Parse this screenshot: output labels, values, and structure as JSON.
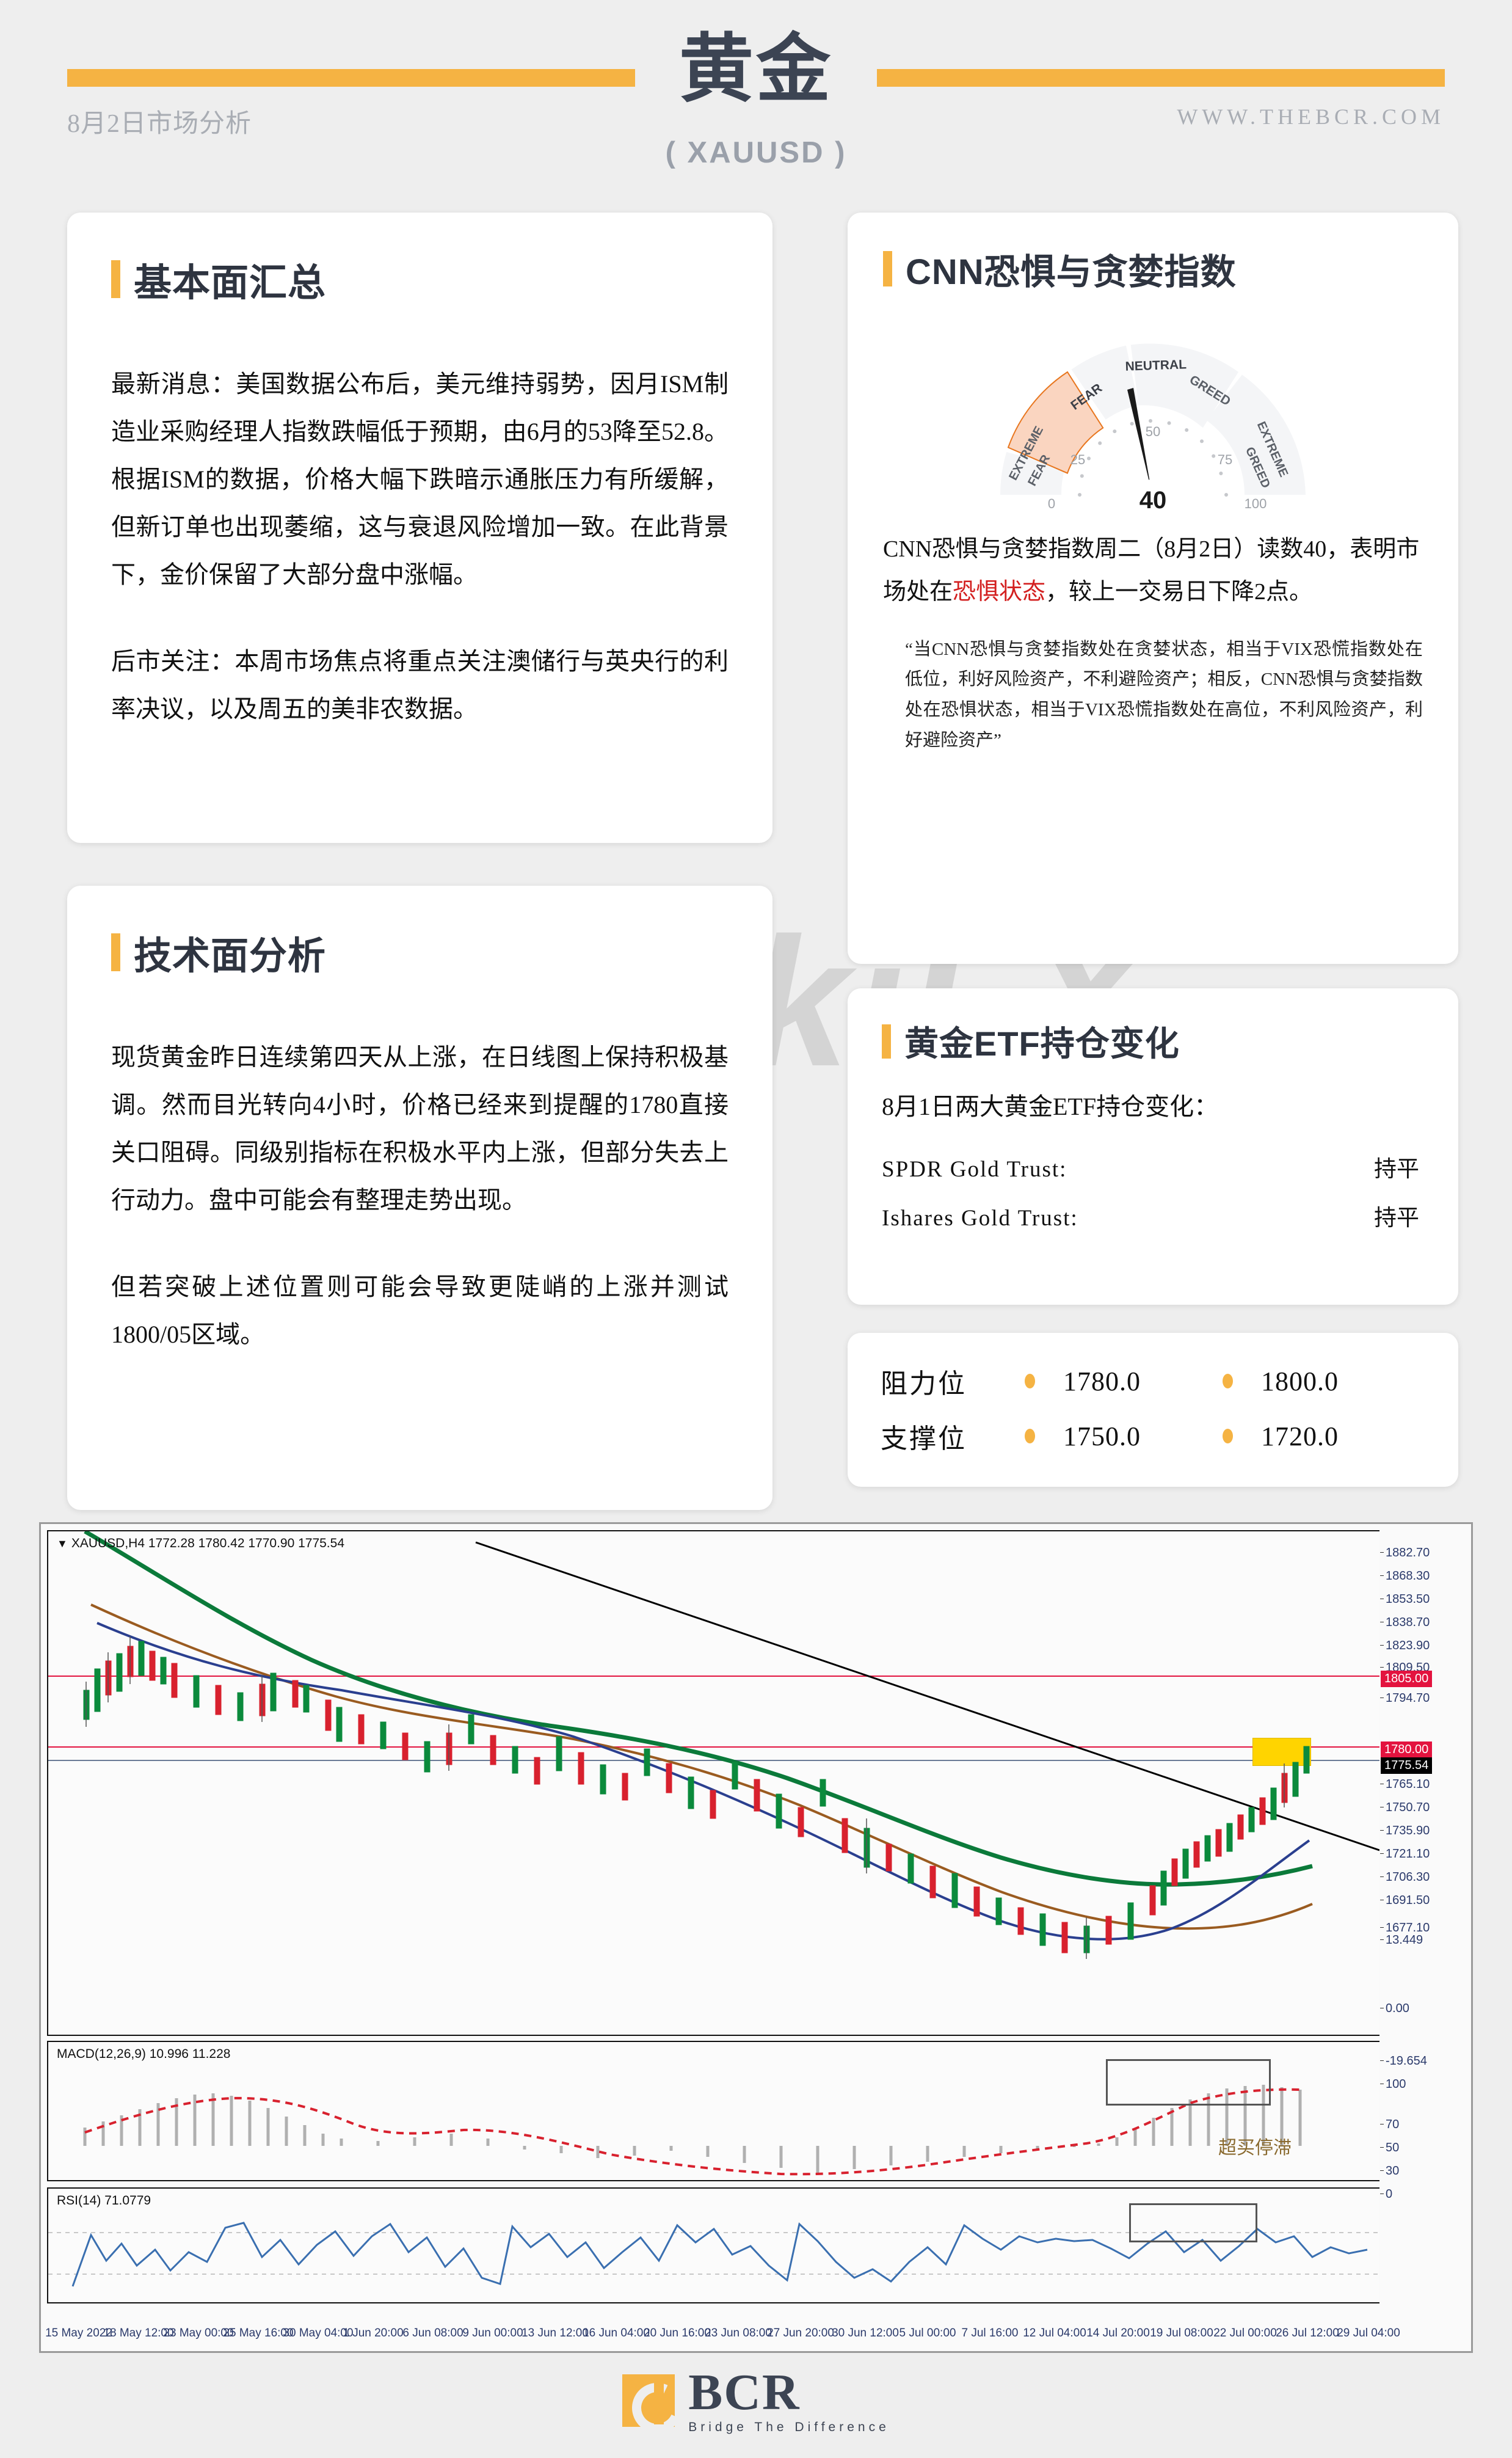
{
  "header": {
    "title": "黄金",
    "subtitle": "( XAUUSD )",
    "date_label": "8月2日市场分析",
    "url": "WWW.THEBCR.COM"
  },
  "watermark": "WikiFX",
  "fundamental": {
    "section_title": "基本面汇总",
    "paragraph1": "最新消息：美国数据公布后，美元维持弱势，因月ISM制造业采购经理人指数跌幅低于预期，由6月的53降至52.8。根据ISM的数据，价格大幅下跌暗示通胀压力有所缓解，但新订单也出现萎缩，这与衰退风险增加一致。在此背景下，金价保留了大部分盘中涨幅。",
    "paragraph2": "后市关注：本周市场焦点将重点关注澳储行与英央行的利率决议，以及周五的美非农数据。"
  },
  "technical": {
    "section_title": "技术面分析",
    "paragraph1": "现货黄金昨日连续第四天从上涨，在日线图上保持积极基调。然而目光转向4小时，价格已经来到提醒的1780直接关口阻碍。同级别指标在积极水平内上涨，但部分失去上行动力。盘中可能会有整理走势出现。",
    "paragraph2": "但若突破上述位置则可能会导致更陡峭的上涨并测试1800/05区域。"
  },
  "cnn": {
    "section_title": "CNN恐惧与贪婪指数",
    "gauge": {
      "value": 40,
      "value_label": "40",
      "scale_labels": [
        "0",
        "25",
        "50",
        "75",
        "100"
      ],
      "zones": [
        {
          "name": "EXTREME FEAR",
          "range": [
            0,
            25
          ],
          "active": false
        },
        {
          "name": "FEAR",
          "range": [
            25,
            45
          ],
          "active": true
        },
        {
          "name": "NEUTRAL",
          "range": [
            45,
            55
          ],
          "active": false
        },
        {
          "name": "GREED",
          "range": [
            55,
            75
          ],
          "active": false
        },
        {
          "name": "EXTREME GREED",
          "range": [
            75,
            100
          ],
          "active": false
        }
      ],
      "active_color": "#fad5c0",
      "active_stroke": "#e8761e",
      "inactive_color": "#f4f5f7"
    },
    "desc_before": "CNN恐惧与贪婪指数周二（8月2日）读数40，表明市场处在",
    "desc_highlight": "恐惧状态",
    "desc_after": "，较上一交易日下降2点。",
    "quote": "“当CNN恐惧与贪婪指数处在贪婪状态，相当于VIX恐慌指数处在低位，利好风险资产，不利避险资产；相反，CNN恐惧与贪婪指数处在恐惧状态，相当于VIX恐慌指数处在高位，不利风险资产，利好避险资产”"
  },
  "etf": {
    "section_title": "黄金ETF持仓变化",
    "lead": "8月1日两大黄金ETF持仓变化：",
    "rows": [
      {
        "name": "SPDR Gold Trust:",
        "value": "持平"
      },
      {
        "name": "Ishares Gold Trust:",
        "value": "持平"
      }
    ]
  },
  "levels": {
    "resistance_label": "阻力位",
    "resistance": [
      "1780.0",
      "1800.0"
    ],
    "support_label": "支撑位",
    "support": [
      "1750.0",
      "1720.0"
    ]
  },
  "chart_data": {
    "type": "line",
    "title": "XAUUSD,H4  1772.28 1780.42 1770.90 1775.54",
    "symbol": "XAUUSD",
    "timeframe": "H4",
    "ohlc": {
      "open": 1772.28,
      "high": 1780.42,
      "low": 1770.9,
      "close": 1775.54
    },
    "xlabel": "",
    "ylabel": "",
    "ylim": [
      1677.1,
      1882.7
    ],
    "grid": false,
    "y_ticks": [
      "1882.70",
      "1868.30",
      "1853.50",
      "1838.70",
      "1823.90",
      "1809.50",
      "1794.70",
      "1765.10",
      "1750.70",
      "1735.90",
      "1721.10",
      "1706.30",
      "1691.50",
      "1677.10"
    ],
    "price_badges": [
      {
        "label": "1805.00",
        "color": "#e3133f",
        "type": "resistance-line"
      },
      {
        "label": "1780.00",
        "color": "#e3133f",
        "type": "resistance-line"
      },
      {
        "label": "1775.54",
        "color": "#000000",
        "type": "last-price"
      }
    ],
    "x_ticks": [
      "15 May 2022",
      "18 May 12:00",
      "23 May 00:00",
      "25 May 16:00",
      "30 May 04:00",
      "1 Jun 20:00",
      "6 Jun 08:00",
      "9 Jun 00:00",
      "13 Jun 12:00",
      "16 Jun 04:00",
      "20 Jun 16:00",
      "23 Jun 08:00",
      "27 Jun 20:00",
      "30 Jun 12:00",
      "5 Jul 00:00",
      "7 Jul 16:00",
      "12 Jul 04:00",
      "14 Jul 20:00",
      "19 Jul 08:00",
      "22 Jul 00:00",
      "26 Jul 12:00",
      "29 Jul 04:00"
    ],
    "indicators": [
      {
        "name": "MACD",
        "params": "(12,26,9)",
        "values": "10.996 11.228",
        "label": "MACD(12,26,9) 10.996 11.228",
        "y_ticks": [
          "13.449",
          "0.00",
          "-19.654"
        ]
      },
      {
        "name": "RSI",
        "params": "(14)",
        "values": "71.0779",
        "label": "RSI(14) 71.0779",
        "y_ticks": [
          "100",
          "70",
          "50",
          "30",
          "0"
        ]
      }
    ],
    "annotations": [
      {
        "text": "超买停滞",
        "panel": "macd"
      }
    ]
  },
  "footer": {
    "brand": "BCR",
    "tagline": "Bridge The Difference"
  }
}
